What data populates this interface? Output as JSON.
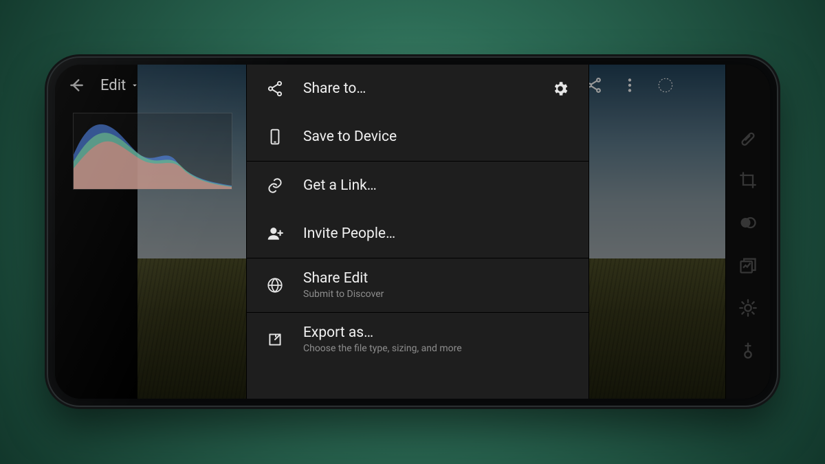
{
  "header": {
    "title": "Edit"
  },
  "menu": {
    "items": [
      {
        "label": "Share to…"
      },
      {
        "label": "Save to Device"
      },
      {
        "label": "Get a Link…"
      },
      {
        "label": "Invite People…"
      },
      {
        "label": "Share Edit",
        "sub": "Submit to Discover"
      },
      {
        "label": "Export as…",
        "sub": "Choose the file type, sizing, and more"
      }
    ]
  }
}
